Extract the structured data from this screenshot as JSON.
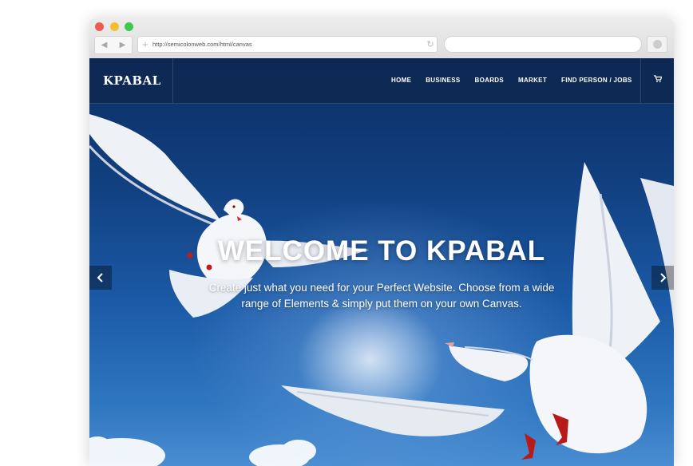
{
  "browser": {
    "url": "http://semicolonweb.com/html/canvas",
    "nav_back_icon": "chevron-left-icon",
    "nav_forward_icon": "chevron-right-icon",
    "reload_icon": "reload-icon"
  },
  "site": {
    "logo": "KPABAL",
    "menu": [
      "HOME",
      "BUSINESS",
      "BOARDS",
      "MARKET",
      "FIND PERSON / JOBS"
    ],
    "cart_icon": "cart-icon"
  },
  "hero": {
    "title": "WELCOME TO KPABAL",
    "subtitle": "Create just what you need for your Perfect Website. Choose from a wide range of Elements & simply put them on your own Canvas.",
    "prev_icon": "chevron-left-icon",
    "next_icon": "chevron-right-icon"
  },
  "colors": {
    "header_bg": "#0e2852",
    "sky_top": "#0b2f63",
    "sky_bottom": "#4a8dd2",
    "dot_red": "#ee5b52",
    "dot_yellow": "#f4be2f",
    "dot_green": "#3fc94a"
  }
}
